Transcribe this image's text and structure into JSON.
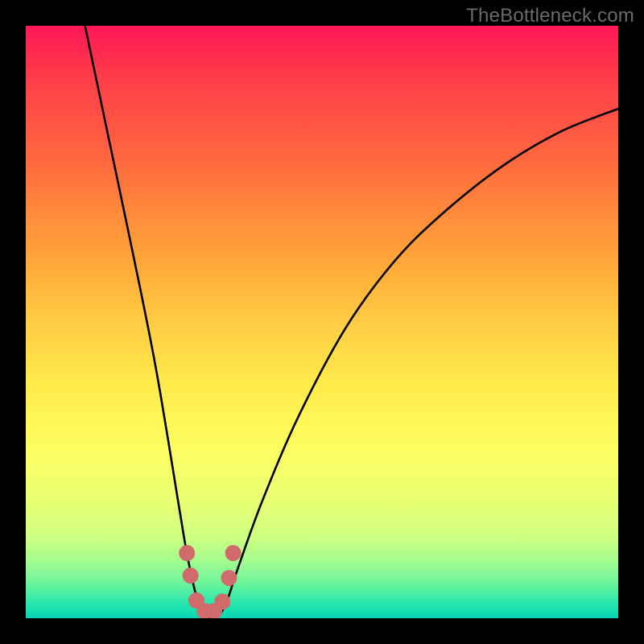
{
  "watermark": "TheBottleneck.com",
  "chart_data": {
    "type": "line",
    "title": "",
    "xlabel": "",
    "ylabel": "",
    "xlim": [
      0,
      100
    ],
    "ylim": [
      0,
      100
    ],
    "series": [
      {
        "name": "bottleneck-curve",
        "x": [
          10,
          14,
          18,
          22,
          26,
          27,
          28,
          29,
          30,
          31,
          32,
          33,
          34,
          36,
          40,
          46,
          54,
          62,
          70,
          80,
          90,
          100
        ],
        "values": [
          100,
          81,
          62,
          42,
          18,
          12,
          7,
          3,
          1,
          0,
          0,
          1,
          3,
          9,
          20,
          34,
          49,
          60,
          68,
          76,
          82,
          86
        ]
      }
    ],
    "markers": [
      {
        "name": "marker-left-top",
        "x": 27.2,
        "y": 11.0
      },
      {
        "name": "marker-left-mid",
        "x": 27.8,
        "y": 7.2
      },
      {
        "name": "marker-bottom-1",
        "x": 28.8,
        "y": 3.0
      },
      {
        "name": "marker-bottom-2",
        "x": 30.2,
        "y": 1.2
      },
      {
        "name": "marker-bottom-3",
        "x": 31.8,
        "y": 1.2
      },
      {
        "name": "marker-bottom-4",
        "x": 33.2,
        "y": 2.8
      },
      {
        "name": "marker-right-mid",
        "x": 34.3,
        "y": 6.8
      },
      {
        "name": "marker-right-top",
        "x": 35.0,
        "y": 11.0
      }
    ],
    "marker_color": "#d16a6a",
    "curve_color": "#000000",
    "gradient_stops": [
      {
        "pos": 0,
        "color": "#ff1757"
      },
      {
        "pos": 40,
        "color": "#ff9a36"
      },
      {
        "pos": 60,
        "color": "#ffe94a"
      },
      {
        "pos": 80,
        "color": "#d0ff80"
      },
      {
        "pos": 100,
        "color": "#0ad3b4"
      }
    ]
  }
}
